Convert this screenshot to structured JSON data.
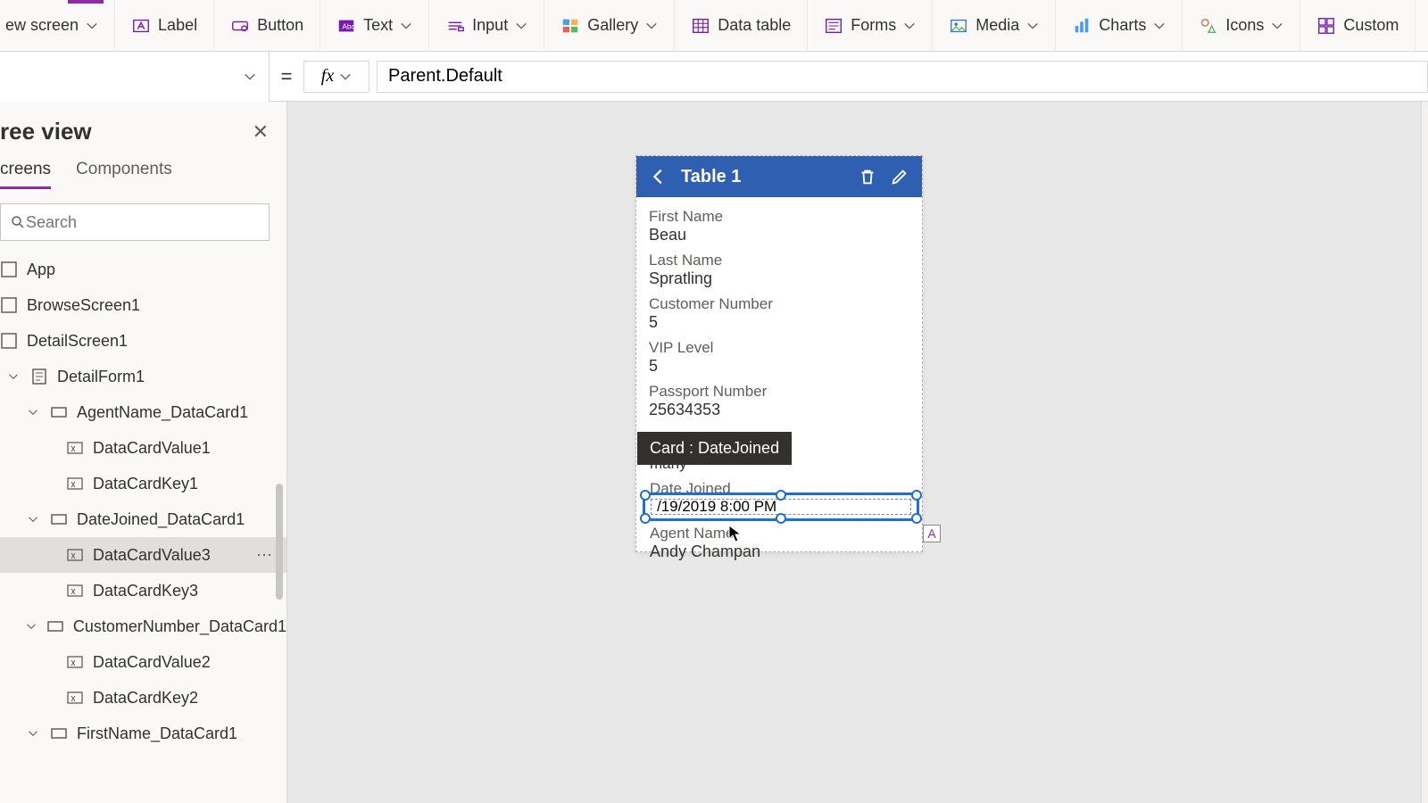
{
  "ribbon": {
    "new_screen": "ew screen",
    "label": "Label",
    "button": "Button",
    "text": "Text",
    "input": "Input",
    "gallery": "Gallery",
    "data_table": "Data table",
    "forms": "Forms",
    "media": "Media",
    "charts": "Charts",
    "icons": "Icons",
    "custom": "Custom"
  },
  "formula": {
    "equals": "=",
    "fx": "fx",
    "value": "Parent.Default"
  },
  "tree": {
    "title": "ree view",
    "tabs": {
      "screens": "creens",
      "components": "Components"
    },
    "search_placeholder": "Search",
    "nodes": {
      "app": "App",
      "browse": "BrowseScreen1",
      "detail_screen": "DetailScreen1",
      "detail_form": "DetailForm1",
      "agent_card": "AgentName_DataCard1",
      "dcv1": "DataCardValue1",
      "dck1": "DataCardKey1",
      "date_card": "DateJoined_DataCard1",
      "dcv3": "DataCardValue3",
      "dck3": "DataCardKey3",
      "cust_card": "CustomerNumber_DataCard1",
      "dcv2": "DataCardValue2",
      "dck2": "DataCardKey2",
      "first_card": "FirstName_DataCard1"
    }
  },
  "form": {
    "title": "Table 1",
    "fields": {
      "first_name_l": "First Name",
      "first_name_v": "Beau",
      "last_name_l": "Last Name",
      "last_name_v": "Spratling",
      "cust_l": "Customer Number",
      "cust_v": "5",
      "vip_l": "VIP Level",
      "vip_v": "5",
      "passport_l": "Passport Number",
      "passport_v": "25634353",
      "country_partial": "many",
      "date_l": "Date Joined",
      "date_v": "/19/2019 8:00 PM",
      "agent_l": "Agent Name",
      "agent_v": "Andy Champan"
    }
  },
  "tooltip": "Card : DateJoined",
  "badge_a": "A"
}
